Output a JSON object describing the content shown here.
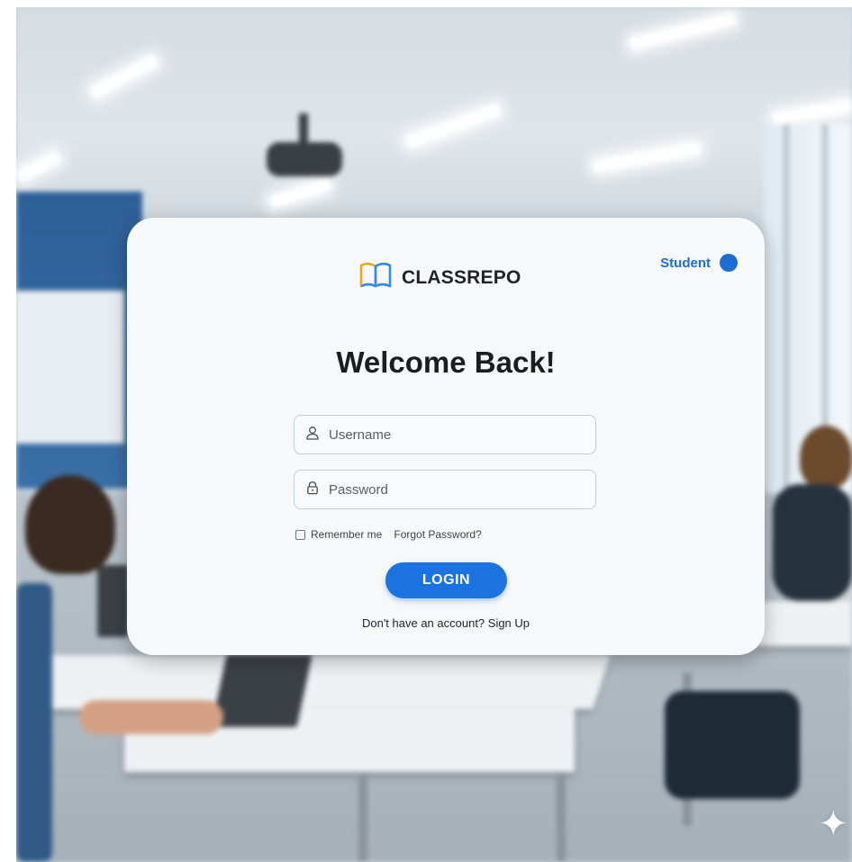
{
  "brand": {
    "name": "CLASSREPO",
    "icon": "open-book-icon"
  },
  "role": {
    "label": "Student"
  },
  "heading": "Welcome Back!",
  "form": {
    "username_placeholder": "Username",
    "password_placeholder": "Password",
    "remember_label": "Remember me",
    "remember_checked": false,
    "forgot_label": "Forgot Password?",
    "login_label": "LOGIN",
    "signup_text": "Don't have an account? Sign Up"
  },
  "colors": {
    "accent": "#1a73e0",
    "brand_icon_blue": "#2f8be6",
    "brand_icon_gold": "#f0a623",
    "card_background": "#f7f8f9"
  }
}
